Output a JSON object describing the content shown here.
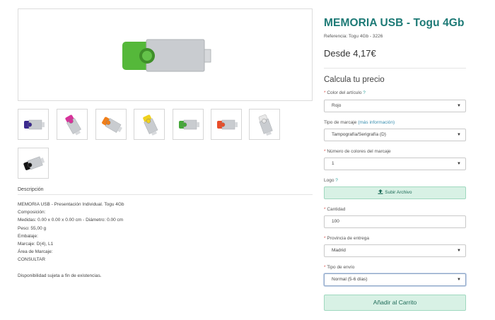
{
  "product": {
    "title": "MEMORIA USB - Togu 4Gb",
    "reference": "Referencia: Togu 4Gb - 3226",
    "price": "Desde 4,17€"
  },
  "gallery": {
    "main_color": "#55b83a",
    "thumbnails": [
      {
        "color": "#3b2a8f",
        "name": "purple"
      },
      {
        "color": "#d7339a",
        "name": "pink"
      },
      {
        "color": "#f07f1a",
        "name": "orange"
      },
      {
        "color": "#f0d11e",
        "name": "yellow"
      },
      {
        "color": "#45a83a",
        "name": "green"
      },
      {
        "color": "#e94e2a",
        "name": "red"
      },
      {
        "color": "#e8e8e8",
        "name": "white"
      },
      {
        "color": "#151515",
        "name": "black"
      }
    ]
  },
  "description": {
    "title": "Descripción",
    "lines": [
      "MEMORIA USB - Presentación Individual. Togu 4Gb",
      "Composición:",
      "Medidas: 0.00 x 0.00 x 0.00 cm - Diámetro: 0.00 cm",
      "Peso: 55,00 g",
      "Embalaje:",
      "Marcaje: D(4), L1",
      "Área de Marcaje:",
      "CONSULTAR"
    ],
    "availability": "Disponibilidad sujeta a fin de existencias."
  },
  "calculator": {
    "heading": "Calcula tu precio",
    "color_label": "Color del artículo",
    "color_value": "Rojo",
    "marking_type_label": "Tipo de marcaje",
    "marking_more_info": "(más información)",
    "marking_type_value": "Tampografía/Serigrafía (D)",
    "marking_colors_label": "Número de colores del marcaje",
    "marking_colors_value": "1",
    "logo_label": "Logo",
    "upload_label": "Subir Archivo",
    "quantity_label": "Cantidad",
    "quantity_value": "100",
    "province_label": "Provincia de entrega",
    "province_value": "Madrid",
    "shipping_label": "Tipo de envío",
    "shipping_value": "Normal (5-6 días)",
    "add_to_cart": "Añadir al Carrito",
    "required_mark": "*",
    "help_mark": "?",
    "caret": "▼"
  }
}
